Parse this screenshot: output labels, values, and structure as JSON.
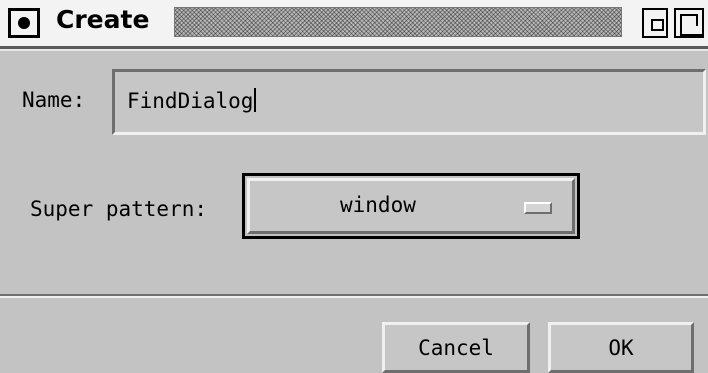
{
  "window": {
    "title": "Create"
  },
  "form": {
    "name_label": "Name:",
    "name_value": "FindDialog",
    "super_label": "Super pattern:",
    "super_value": "window"
  },
  "buttons": {
    "cancel_label": "Cancel",
    "ok_label": "OK"
  },
  "icons": {
    "window_menu": "window-menu-icon",
    "minimize": "minimize-icon",
    "maximize": "maximize-icon",
    "option_menu": "option-menu-indicator-icon"
  },
  "colors": {
    "background": "#c3c3c3",
    "titlebar": "#f3f3f3"
  }
}
